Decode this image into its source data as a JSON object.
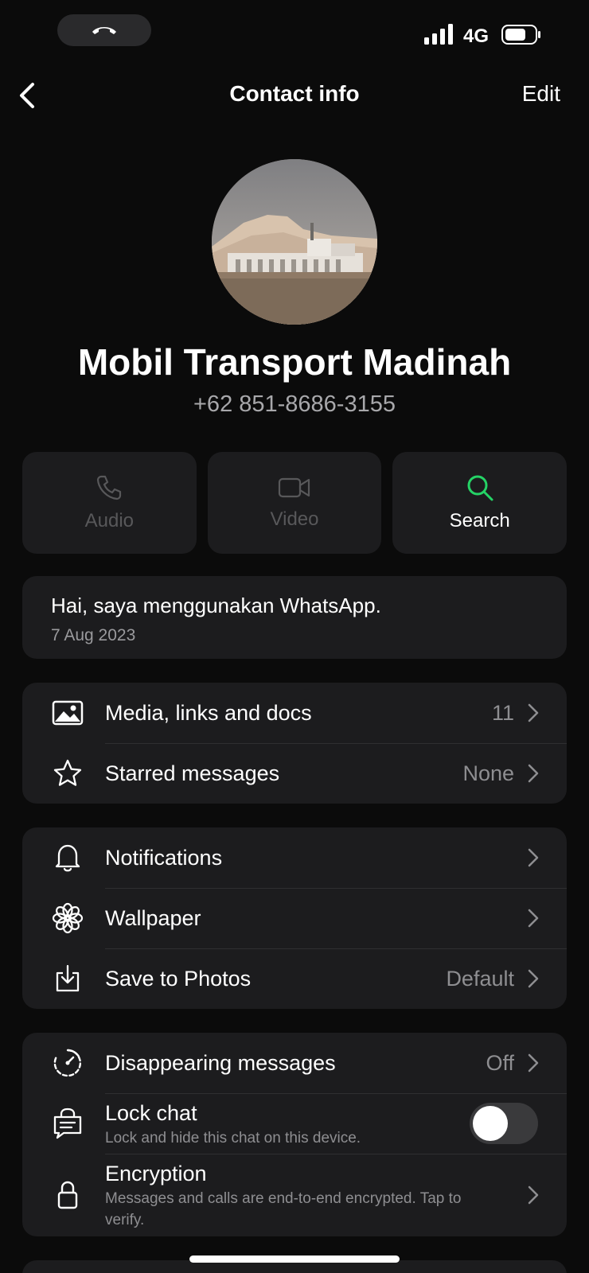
{
  "status_bar": {
    "network": "4G"
  },
  "header": {
    "title": "Contact info",
    "edit_label": "Edit"
  },
  "contact": {
    "name": "Mobil Transport Madinah",
    "phone": "+62 851-8686-3155"
  },
  "actions": [
    {
      "label": "Audio",
      "icon": "phone-icon",
      "enabled": false
    },
    {
      "label": "Video",
      "icon": "video-icon",
      "enabled": false
    },
    {
      "label": "Search",
      "icon": "search-icon",
      "enabled": true
    }
  ],
  "about": {
    "text": "Hai, saya menggunakan WhatsApp.",
    "date": "7 Aug 2023"
  },
  "media_section": [
    {
      "label": "Media, links and docs",
      "value": "11",
      "icon": "image-icon"
    },
    {
      "label": "Starred messages",
      "value": "None",
      "icon": "star-icon"
    }
  ],
  "settings_section": [
    {
      "label": "Notifications",
      "value": "",
      "icon": "bell-icon"
    },
    {
      "label": "Wallpaper",
      "value": "",
      "icon": "flower-icon"
    },
    {
      "label": "Save to Photos",
      "value": "Default",
      "icon": "download-icon"
    }
  ],
  "privacy_section": {
    "disappearing": {
      "label": "Disappearing messages",
      "value": "Off"
    },
    "lock_chat": {
      "label": "Lock chat",
      "subtitle": "Lock and hide this chat on this device.",
      "enabled": false
    },
    "encryption": {
      "label": "Encryption",
      "subtitle": "Messages and calls are end-to-end encrypted. Tap to verify."
    }
  },
  "colors": {
    "accent": "#25d366",
    "background": "#0b0b0b",
    "card": "#1c1c1e",
    "muted": "#8e8e91"
  }
}
